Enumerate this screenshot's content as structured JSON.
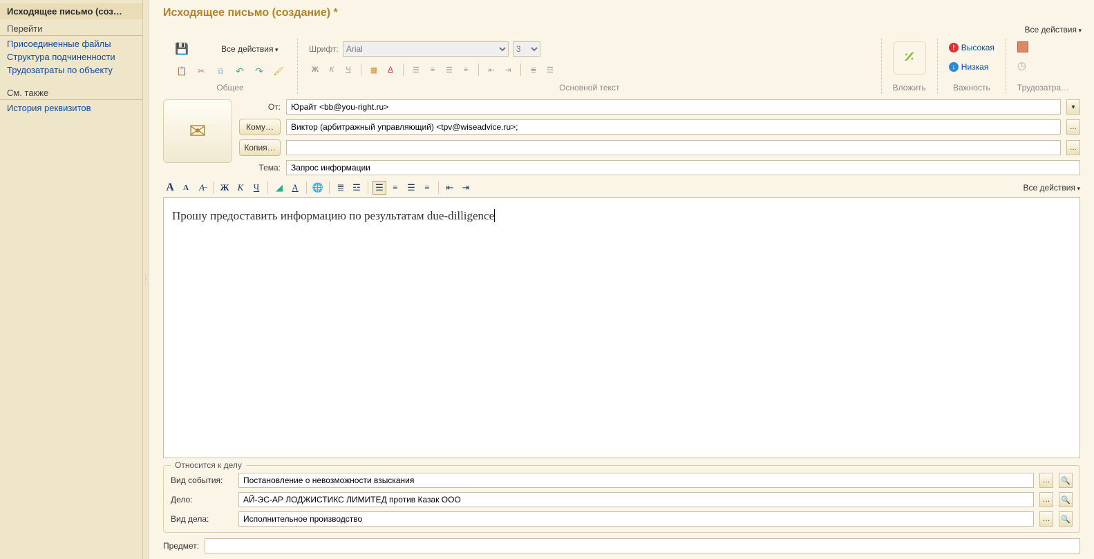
{
  "sidebar": {
    "title": "Исходящее письмо (соз…",
    "nav_header": "Перейти",
    "links": [
      "Присоединенные файлы",
      "Структура подчиненности",
      "Трудозатраты по объекту"
    ],
    "see_also_header": "См. также",
    "see_also_links": [
      "История реквизитов"
    ]
  },
  "page": {
    "title": "Исходящее письмо (создание) *",
    "all_actions": "Все действия"
  },
  "ribbon": {
    "group_general": "Общее",
    "general_all_actions": "Все действия",
    "font_label": "Шрифт:",
    "font_name": "Arial",
    "font_size": "3",
    "group_text": "Основной текст",
    "attach_label": "Вложить",
    "priority_label": "Важность",
    "priority_high": "Высокая",
    "priority_low": "Низкая",
    "effort_label": "Трудозатра…"
  },
  "header": {
    "from_label": "От:",
    "from_value": "Юрайт <bb@you-right.ru>",
    "to_btn": "Кому…",
    "to_value": "Виктор (арбитражный управляющий) <tpv@wiseadvice.ru>;",
    "cc_btn": "Копия…",
    "cc_value": "",
    "subject_label": "Тема:",
    "subject_value": "Запрос информации"
  },
  "editor": {
    "all_actions": "Все действия",
    "content": "Прошу предоставить информацию по результатам due-dilligence"
  },
  "case": {
    "legend": "Относится к делу",
    "event_type_label": "Вид события:",
    "event_type": "Постановление о невозможности взыскания",
    "case_label": "Дело:",
    "case_value": "АЙ-ЭС-АР ЛОДЖИСТИКС ЛИМИТЕД против Казак ООО",
    "case_type_label": "Вид дела:",
    "case_type": "Исполнительное производство"
  },
  "bottom": {
    "subject_label": "Предмет:",
    "subject_value": ""
  }
}
